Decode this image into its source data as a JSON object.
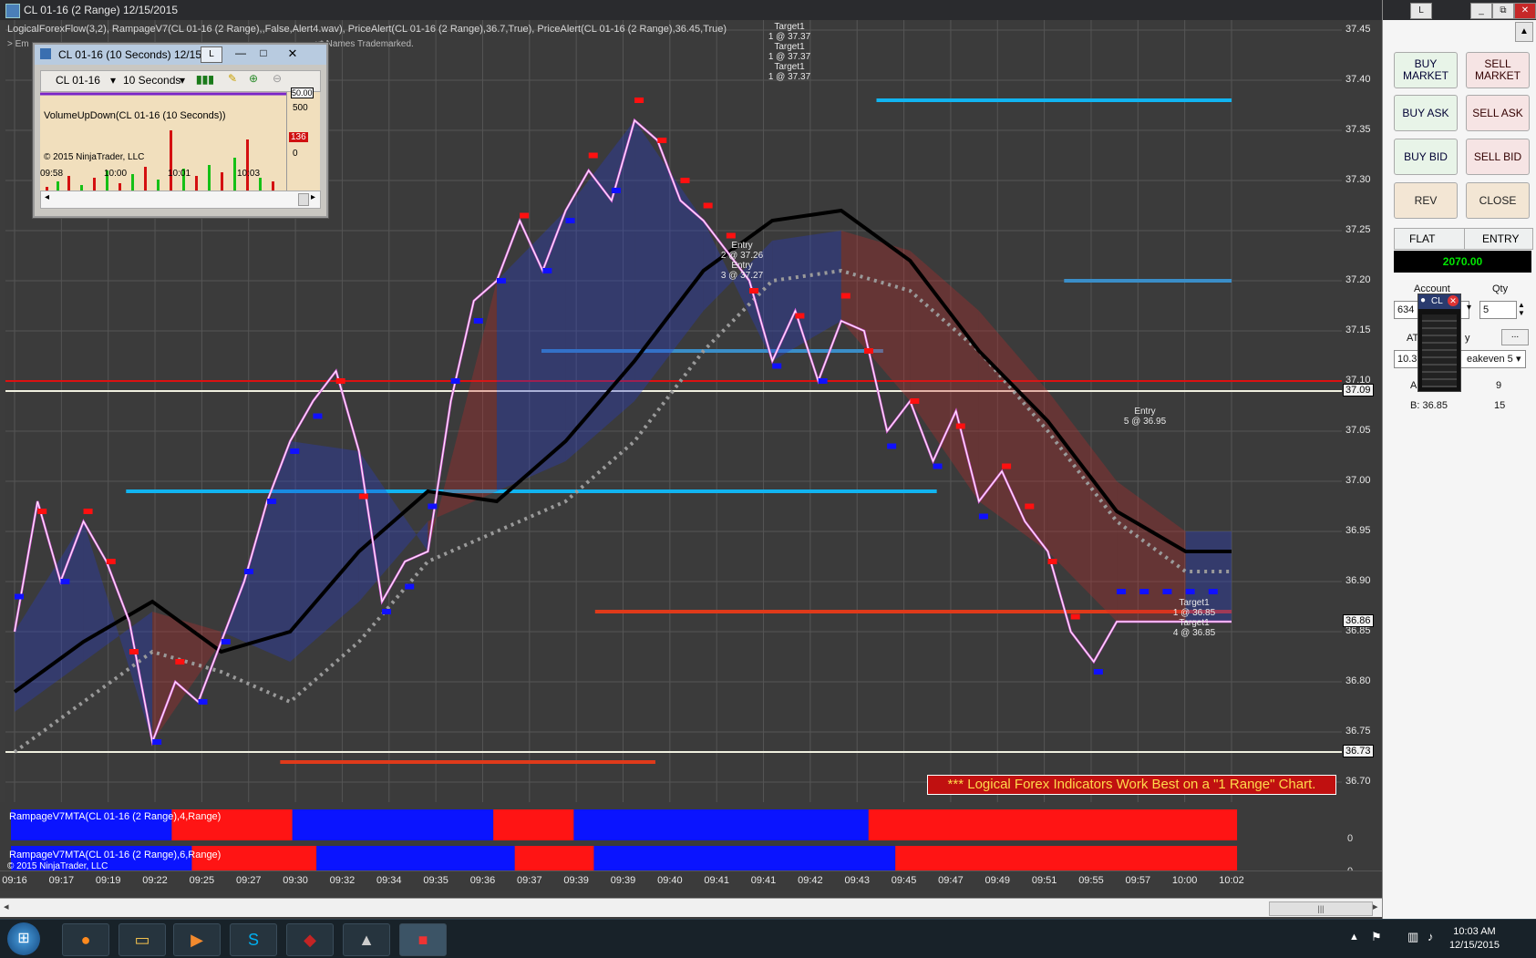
{
  "window": {
    "title": "CL 01-16 (2 Range)  12/15/2015",
    "indicator_string": "LogicalForexFlow(3,2),  RampageV7(CL 01-16 (2 Range),,False,Alert4.wav), PriceAlert(CL 01-16 (2 Range),36.7,True), PriceAlert(CL 01-16 (2 Range),36.45,True)",
    "indicator_string_2": "> Em",
    "indicator_string_3": "x* Names Trademarked."
  },
  "mini_chart": {
    "title": "CL 01-16 (10 Seconds)  12/15",
    "instrument": "CL 01-16",
    "interval": "10 Seconds",
    "indicator_label": "VolumeUpDown(CL 01-16 (10 Seconds))",
    "copyright": "© 2015 NinjaTrader, LLC",
    "axis_labels": [
      "500",
      "0"
    ],
    "axis_partial": "50.00",
    "last_value": "136",
    "time_labels": [
      "09:58",
      "10:00",
      "10:01",
      "10:03"
    ],
    "btn_l": "L"
  },
  "chart_data": {
    "type": "line",
    "title": "CL 01-16 (2 Range)  12/15/2015",
    "ylim": [
      36.68,
      37.46
    ],
    "y_ticks": [
      "37.45",
      "37.40",
      "37.35",
      "37.30",
      "37.25",
      "37.20",
      "37.15",
      "37.10",
      "37.05",
      "37.00",
      "36.95",
      "36.90",
      "36.85",
      "36.80",
      "36.75",
      "36.70"
    ],
    "price_box_labels": [
      "37.09",
      "36.86",
      "36.73"
    ],
    "x_tick_labels": [
      "09:16",
      "09:17",
      "09:19",
      "09:22",
      "09:25",
      "09:27",
      "09:30",
      "09:32",
      "09:34",
      "09:35",
      "09:36",
      "09:37",
      "09:39",
      "09:39",
      "09:40",
      "09:41",
      "09:41",
      "09:42",
      "09:43",
      "09:45",
      "09:47",
      "09:49",
      "09:51",
      "09:55",
      "09:57",
      "10:00",
      "10:02"
    ],
    "series": [
      {
        "x": [
          0,
          10,
          20,
          30,
          40,
          50,
          60,
          70,
          80,
          90,
          100,
          110,
          120,
          130,
          140,
          150,
          160,
          170,
          180,
          190,
          200,
          210,
          220,
          230,
          240,
          250,
          260,
          270,
          280,
          290,
          300,
          310,
          320,
          330,
          340,
          350,
          360,
          370,
          380,
          390,
          400,
          410,
          420,
          430,
          440,
          450,
          460,
          470,
          480,
          490,
          500,
          510,
          520,
          530
        ],
        "values": [
          36.85,
          36.98,
          36.9,
          36.96,
          36.92,
          36.86,
          36.74,
          36.8,
          36.78,
          36.84,
          36.9,
          36.98,
          37.04,
          37.08,
          37.11,
          37.03,
          36.88,
          36.92,
          36.93,
          37.08,
          37.18,
          37.2,
          37.26,
          37.21,
          37.27,
          37.31,
          37.28,
          37.36,
          37.34,
          37.28,
          37.26,
          37.23,
          37.2,
          37.12,
          37.17,
          37.1,
          37.16,
          37.15,
          37.05,
          37.08,
          37.02,
          37.07,
          36.98,
          37.01,
          36.96,
          36.93,
          36.85,
          36.82,
          36.86,
          36.86,
          36.86,
          36.86,
          36.86,
          36.86
        ]
      },
      {
        "x": [
          0,
          30,
          60,
          90,
          120,
          150,
          180,
          210,
          240,
          270,
          300,
          330,
          360,
          390,
          420,
          450,
          480,
          510,
          530
        ],
        "values": [
          36.79,
          36.84,
          36.88,
          36.83,
          36.85,
          36.93,
          36.99,
          36.98,
          37.04,
          37.12,
          37.21,
          37.26,
          37.27,
          37.22,
          37.13,
          37.06,
          36.97,
          36.93,
          36.93
        ]
      },
      {
        "x": [
          0,
          30,
          60,
          90,
          120,
          150,
          180,
          210,
          240,
          270,
          300,
          330,
          360,
          390,
          420,
          450,
          480,
          510,
          530
        ],
        "values": [
          36.77,
          36.82,
          36.87,
          36.85,
          36.82,
          36.88,
          36.96,
          36.99,
          37.02,
          37.08,
          37.17,
          37.24,
          37.25,
          37.23,
          37.17,
          37.09,
          37.0,
          36.95,
          36.95
        ]
      }
    ],
    "horizontal_lines": [
      {
        "price": 37.1,
        "color": "#dd1111"
      },
      {
        "price": 37.09,
        "color": "#f0f0e0"
      },
      {
        "price": 36.73,
        "color": "#f0f0e0"
      }
    ],
    "segments": [
      {
        "price": 37.38,
        "from": 0.65,
        "to": 0.915,
        "color": "#11b4f0"
      },
      {
        "price": 37.2,
        "from": 0.79,
        "to": 0.915,
        "color": "#3a8ec8"
      },
      {
        "price": 37.13,
        "from": 0.4,
        "to": 0.655,
        "color": "#3a8ec8"
      },
      {
        "price": 36.99,
        "from": 0.09,
        "to": 0.695,
        "color": "#11b4f0"
      },
      {
        "price": 36.87,
        "from": 0.44,
        "to": 0.915,
        "color": "#e03a1a"
      },
      {
        "price": 36.72,
        "from": 0.205,
        "to": 0.485,
        "color": "#e03a1a"
      }
    ],
    "annotations": [
      {
        "text": "Target1",
        "line2": "1 @ 37.37"
      },
      {
        "text": "Target1",
        "line2": "1 @ 37.37"
      },
      {
        "text": "Target1",
        "line2": "1 @ 37.37"
      },
      {
        "text": "Entry",
        "line2": "2 @ 37.26"
      },
      {
        "text": "Entry",
        "line2": "3 @ 37.27"
      },
      {
        "text": "Entry",
        "line2": "5 @ 36.95"
      },
      {
        "text": "Target1",
        "line2": "1 @ 36.85"
      },
      {
        "text": "Target1",
        "line2": "4 @ 36.85"
      }
    ],
    "banner": "*** Logical Forex Indicators Work Best on a \"1 Range\" Chart.",
    "subpanels": [
      {
        "label": "RampageV7MTA(CL 01-16 (2 Range),4,Range)",
        "zero": "0",
        "blocks": [
          [
            "blue",
            0.0,
            0.12
          ],
          [
            "red",
            0.12,
            0.21
          ],
          [
            "blue",
            0.21,
            0.36
          ],
          [
            "red",
            0.36,
            0.42
          ],
          [
            "blue",
            0.42,
            0.64
          ],
          [
            "red",
            0.64,
            0.915
          ]
        ]
      },
      {
        "label": "RampageV7MTA(CL 01-16 (2 Range),6,Range)",
        "zero": "0",
        "blocks": [
          [
            "blue",
            0.0,
            0.135
          ],
          [
            "red",
            0.135,
            0.228
          ],
          [
            "blue",
            0.228,
            0.376
          ],
          [
            "red",
            0.376,
            0.435
          ],
          [
            "blue",
            0.435,
            0.66
          ],
          [
            "red",
            0.66,
            0.915
          ]
        ]
      }
    ],
    "subpanel_copyright": "© 2015 NinjaTrader, LLC"
  },
  "trade_panel": {
    "top_buttons": [
      "L",
      "□",
      "⧉",
      "✕"
    ],
    "buy_market": "BUY MARKET",
    "sell_market": "SELL MARKET",
    "buy_ask": "BUY ASK",
    "sell_ask": "SELL ASK",
    "buy_bid": "BUY BID",
    "sell_bid": "SELL BID",
    "rev": "REV",
    "close": "CLOSE",
    "position": "FLAT",
    "entry_label": "ENTRY",
    "pnl": "2070.00",
    "account_label": "Account",
    "account_value": "634",
    "qty_label": "Qty",
    "qty_value": "5",
    "atm_label": "AT",
    "atm_label2": "y",
    "atm_value": "10.3",
    "atm_value2": "eakeven 5",
    "ellipsis": "...",
    "ask_label": "A",
    "ask_qty": "9",
    "bid_label": "B: 36.85",
    "bid_qty": "15",
    "popup_label": "CL"
  },
  "taskbar": {
    "time": "10:03 AM",
    "date": "12/15/2015"
  }
}
